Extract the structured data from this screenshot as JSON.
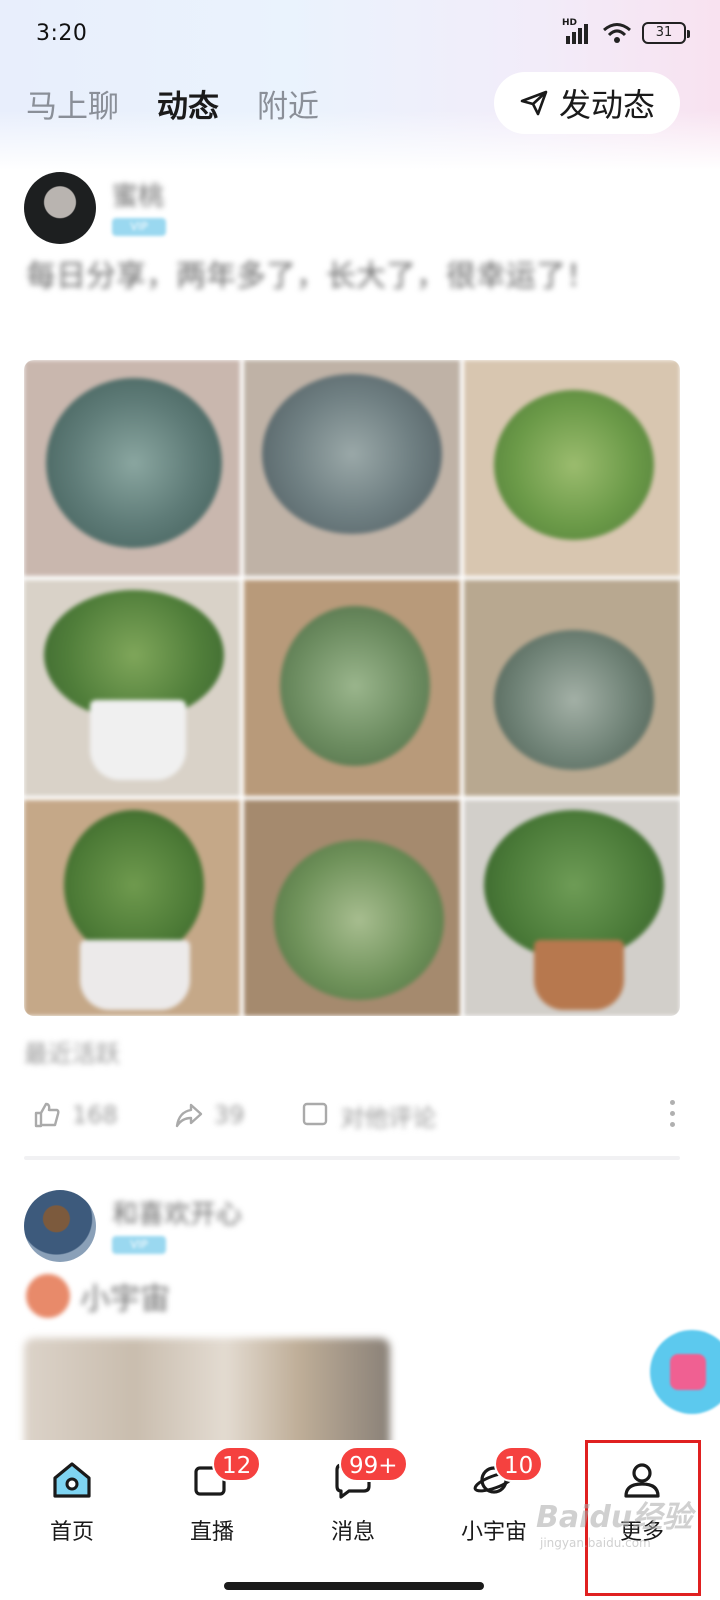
{
  "status_bar": {
    "time": "3:20",
    "network": "HD",
    "battery": "31"
  },
  "top_nav": {
    "tabs": [
      {
        "label": "马上聊",
        "active": false
      },
      {
        "label": "动态",
        "active": true
      },
      {
        "label": "附近",
        "active": false
      }
    ],
    "post_button_label": "发动态"
  },
  "feed": {
    "posts": [
      {
        "user_name": "蜜桃",
        "user_tag": "VIP",
        "text": "每日分享，两年多了，长大了，很幸运了！",
        "photo_count": 9,
        "meta": "最近活跃",
        "likes": "168",
        "shares": "39",
        "comments": "对他评论"
      },
      {
        "user_name": "和喜欢开心",
        "user_tag": "VIP",
        "sub_text": "小宇宙"
      }
    ]
  },
  "tab_bar": {
    "tabs": [
      {
        "label": "首页",
        "icon": "home-icon",
        "badge": ""
      },
      {
        "label": "直播",
        "icon": "live-icon",
        "badge": "12"
      },
      {
        "label": "消息",
        "icon": "message-icon",
        "badge": "99+"
      },
      {
        "label": "小宇宙",
        "icon": "planet-icon",
        "badge": "10"
      },
      {
        "label": "更多",
        "icon": "person-icon",
        "badge": ""
      }
    ]
  },
  "watermark": {
    "text": "Baidu经验",
    "sub": "jingyan.baidu.com"
  },
  "colors": {
    "accent_home": "#2db3e6",
    "badge": "#f5413f",
    "highlight_box": "#e02020"
  }
}
